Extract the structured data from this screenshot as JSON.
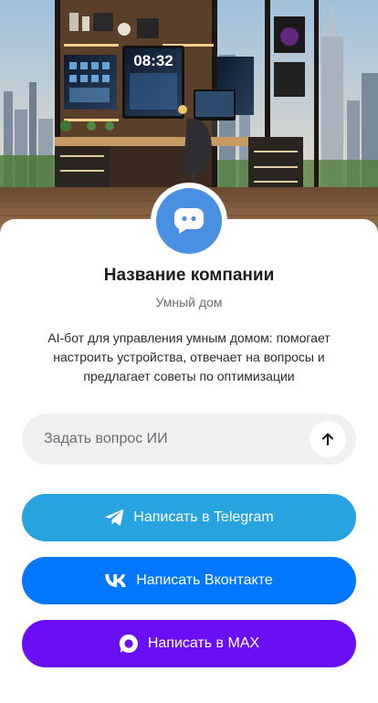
{
  "colors": {
    "avatar": "#4a90e2",
    "telegram": "#27a3df",
    "vkontakte": "#0077ff",
    "max": "#6a0ff5",
    "input_bg": "#f0f0f2"
  },
  "hero": {
    "clock_text": "08:32",
    "icon": "smart-home-office-illustration"
  },
  "company": {
    "avatar_icon": "chat-bot-icon",
    "name": "Название компании",
    "subtitle": "Умный дом",
    "description": "AI-бот для управления умным домом: помогает настроить устройства, отвечает на вопросы и предлагает советы по оптимизации"
  },
  "ask": {
    "placeholder": "Задать вопрос ИИ",
    "value": "",
    "send_icon": "arrow-up-icon"
  },
  "buttons": {
    "telegram": {
      "label": "Написать в Telegram",
      "icon": "telegram-icon"
    },
    "vkontakte": {
      "label": "Написать Вконтакте",
      "icon": "vk-icon"
    },
    "max": {
      "label": "Написать в MAX",
      "icon": "max-icon"
    }
  }
}
